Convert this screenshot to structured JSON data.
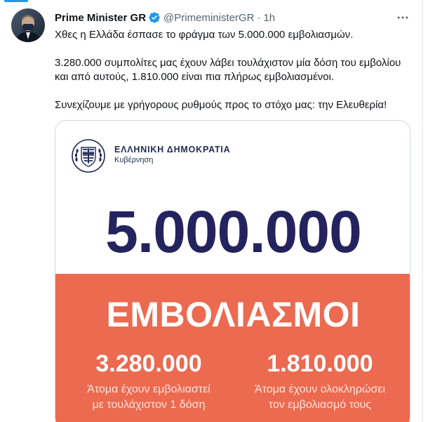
{
  "tweet": {
    "author_name": "Prime Minister GR",
    "handle": "@PrimeministerGR",
    "separator": "·",
    "time": "1h",
    "paragraphs": [
      "Χθες η Ελλάδα έσπασε το φράγμα των 5.000.000 εμβολιασμών.",
      "3.280.000 συμπολίτες μας έχουν λάβει τουλάχιστον μία δόση του εμβολίου και από αυτούς, 1.810.000 είναι πια πλήρως εμβολιασμένοι.",
      "Συνεχίζουμε με γρήγορους ρυθμούς προς το στόχο μας: την Ελευθερία!"
    ]
  },
  "card": {
    "gov_title": "ΕΛΛΗΝΙΚΗ ΔΗΜΟΚΡΑΤΙΑ",
    "gov_subtitle": "Κυβέρνηση",
    "big_number": "5.000.000",
    "section_title": "ΕΜΒΟΛΙΑΣΜΟΙ",
    "stats": [
      {
        "value": "3.280.000",
        "label_line1": "Άτομα έχουν εμβολιαστεί",
        "label_line2": "με τουλάχιστον 1 δόση"
      },
      {
        "value": "1.810.000",
        "label_line1": "Άτομα έχουν ολοκληρώσει",
        "label_line2": "τον εμβολιασμό τους"
      }
    ]
  },
  "icons": {
    "verified": "verified-badge-icon",
    "more": "more-options-icon",
    "emblem": "greek-coat-of-arms-icon"
  },
  "colors": {
    "accent": "#1d9bf0",
    "text": "#0f1419",
    "muted": "#536471",
    "navy": "#24235e",
    "coral": "#ec6a50"
  }
}
